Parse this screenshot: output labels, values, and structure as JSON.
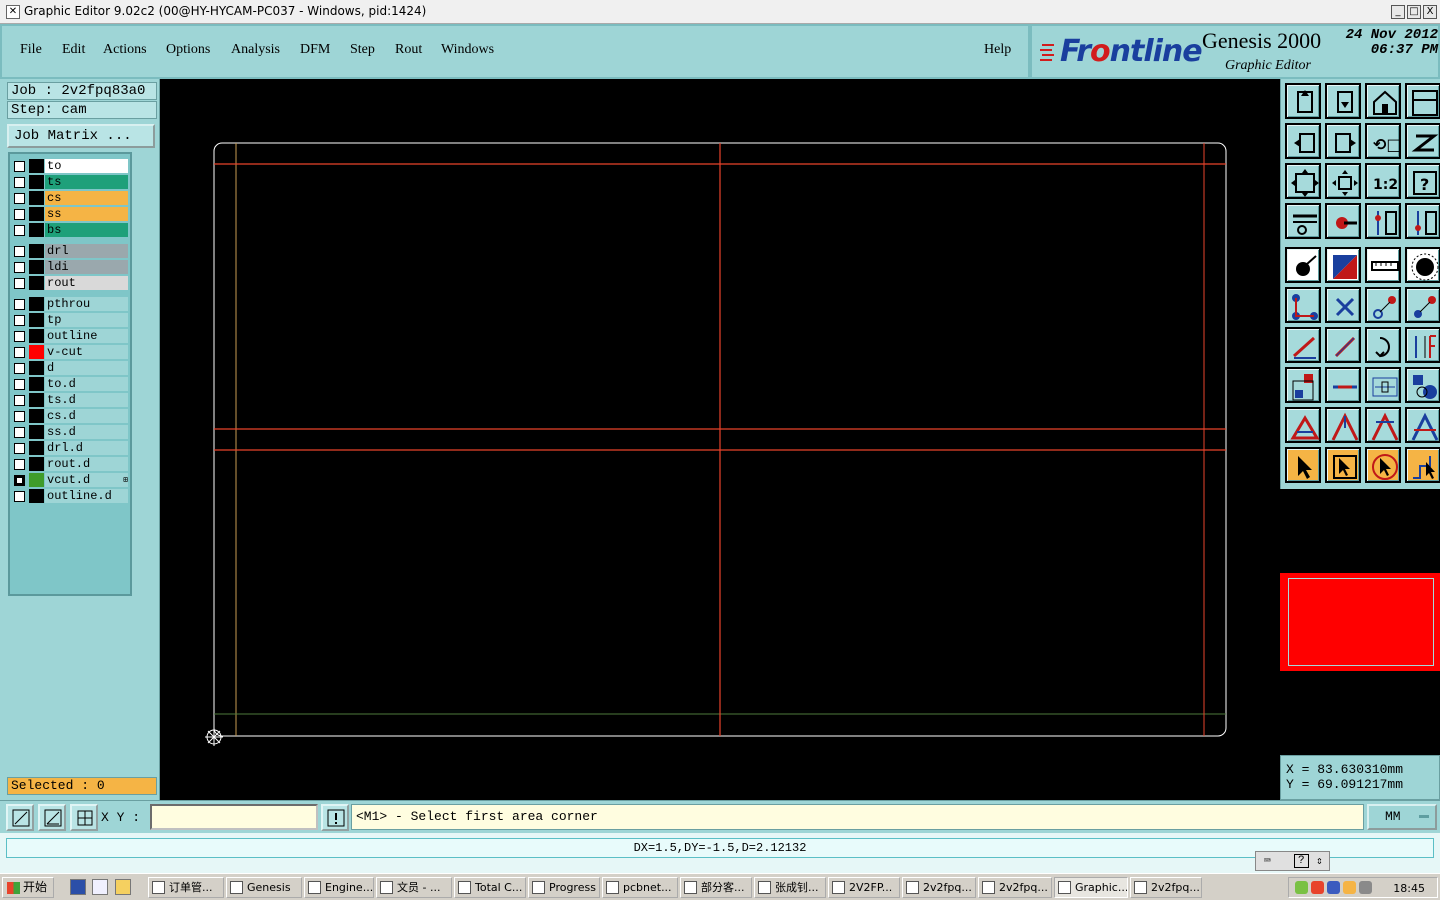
{
  "window": {
    "title": "Graphic Editor 9.02c2 (00@HY-HYCAM-PC037 - Windows, pid:1424)",
    "controls": [
      "_",
      "□",
      "X"
    ]
  },
  "menu": {
    "items": [
      "File",
      "Edit",
      "Actions",
      "Options",
      "Analysis",
      "DFM",
      "Step",
      "Rout",
      "Windows"
    ],
    "help": "Help"
  },
  "brand": {
    "logo_pre": "Fr",
    "logo_o": "o",
    "logo_post": "ntline",
    "product": "Genesis 2000",
    "subtitle": "Graphic Editor",
    "date_line1": "24 Nov 2012",
    "date_line2": "06:37 PM"
  },
  "left": {
    "job": "Job : 2v2fpq83a0",
    "step": "Step: cam",
    "job_matrix": "Job Matrix ...",
    "selected": "Selected : 0"
  },
  "layers": [
    {
      "name": "to",
      "bg": "#ffffff",
      "swatch": "#000000",
      "checked": false,
      "mark": ""
    },
    {
      "name": "ts",
      "bg": "#1ea07a",
      "swatch": "#000000",
      "checked": false,
      "mark": ""
    },
    {
      "name": "cs",
      "bg": "#f5b445",
      "swatch": "#000000",
      "checked": false,
      "mark": ""
    },
    {
      "name": "ss",
      "bg": "#f5b445",
      "swatch": "#000000",
      "checked": false,
      "mark": ""
    },
    {
      "name": "bs",
      "bg": "#1ea07a",
      "swatch": "#000000",
      "checked": false,
      "mark": ""
    },
    {
      "name": "drl",
      "bg": "#9aa8ad",
      "swatch": "#000000",
      "checked": false,
      "mark": ""
    },
    {
      "name": "ldi",
      "bg": "#9aa8ad",
      "swatch": "#000000",
      "checked": false,
      "mark": ""
    },
    {
      "name": "rout",
      "bg": "#d9d9d9",
      "swatch": "#000000",
      "checked": false,
      "mark": ""
    },
    {
      "name": "pthrou",
      "bg": "#9ed5d6",
      "swatch": "#000000",
      "checked": false,
      "mark": ""
    },
    {
      "name": "tp",
      "bg": "#9ed5d6",
      "swatch": "#000000",
      "checked": false,
      "mark": ""
    },
    {
      "name": "outline",
      "bg": "#9ed5d6",
      "swatch": "#000000",
      "checked": false,
      "mark": ""
    },
    {
      "name": "v-cut",
      "bg": "#9ed5d6",
      "swatch": "#ff0000",
      "checked": false,
      "mark": ""
    },
    {
      "name": "d",
      "bg": "#9ed5d6",
      "swatch": "#000000",
      "checked": false,
      "mark": ""
    },
    {
      "name": "to.d",
      "bg": "#9ed5d6",
      "swatch": "#000000",
      "checked": false,
      "mark": ""
    },
    {
      "name": "ts.d",
      "bg": "#9ed5d6",
      "swatch": "#000000",
      "checked": false,
      "mark": ""
    },
    {
      "name": "cs.d",
      "bg": "#9ed5d6",
      "swatch": "#000000",
      "checked": false,
      "mark": ""
    },
    {
      "name": "ss.d",
      "bg": "#9ed5d6",
      "swatch": "#000000",
      "checked": false,
      "mark": ""
    },
    {
      "name": "drl.d",
      "bg": "#9ed5d6",
      "swatch": "#000000",
      "checked": false,
      "mark": ""
    },
    {
      "name": "rout.d",
      "bg": "#9ed5d6",
      "swatch": "#000000",
      "checked": false,
      "mark": ""
    },
    {
      "name": "vcut.d",
      "bg": "#9ed5d6",
      "swatch": "#3f9c2a",
      "checked": true,
      "mark": "⊞"
    },
    {
      "name": "outline.d",
      "bg": "#9ed5d6",
      "swatch": "#000000",
      "checked": false,
      "mark": ""
    }
  ],
  "coords": {
    "x": "X = 83.630310mm",
    "y": "Y = 69.091217mm"
  },
  "command": {
    "xy_label": "X Y :",
    "xy_value": "",
    "exclaim": "!",
    "prompt": "<M1> - Select first area corner",
    "units": "MM"
  },
  "status": {
    "text": "DX=1.5,DY=-1.5,D=2.12132",
    "tray_help": "?"
  },
  "taskbar": {
    "start": "开始",
    "tasks": [
      "订单管...",
      "Genesis",
      "Engine...",
      "文员 - ...",
      "Total C...",
      "Progress",
      "pcbnet...",
      "部分客...",
      "张成钊...",
      "2V2FP...",
      "2v2fpq...",
      "2v2fpq...",
      "Graphic...",
      "2v2fpq..."
    ],
    "active_task": "Graphic...",
    "clock": "18:45"
  },
  "colors": {
    "panel": "#9ed5d6",
    "canvas": "#000000",
    "vcut": "#e8432b",
    "outline": "#ffffff",
    "minimap": "#ff0000",
    "selected": "#f5b445"
  },
  "icons": {
    "toolbox": [
      "open-job-icon",
      "save-job-icon",
      "home-icon",
      "window-split-icon",
      "import-icon",
      "export-icon",
      "undo-icon",
      "redo-icon",
      "zoom-fit-icon",
      "zoom-profile-icon",
      "zoom-1-1-icon",
      "help-icon",
      "measure-tool-icon",
      "snap-icon",
      "layer-attr-icon",
      "layer-attr2-icon",
      "pad-icon",
      "color-icon",
      "ruler-icon",
      "circle-icon",
      "net-icon",
      "cross-icon",
      "arc-icon",
      "line-arc-icon",
      "line-add-icon",
      "line-edit-icon",
      "rotate-icon",
      "mirror-icon",
      "feature-add-icon",
      "segment-icon",
      "dimension-icon",
      "shapes-icon",
      "poly-icon",
      "poly2-icon",
      "poly3-icon",
      "poly4-icon",
      "select-icon",
      "select-box-icon",
      "select-all-icon",
      "select-move-icon"
    ]
  }
}
